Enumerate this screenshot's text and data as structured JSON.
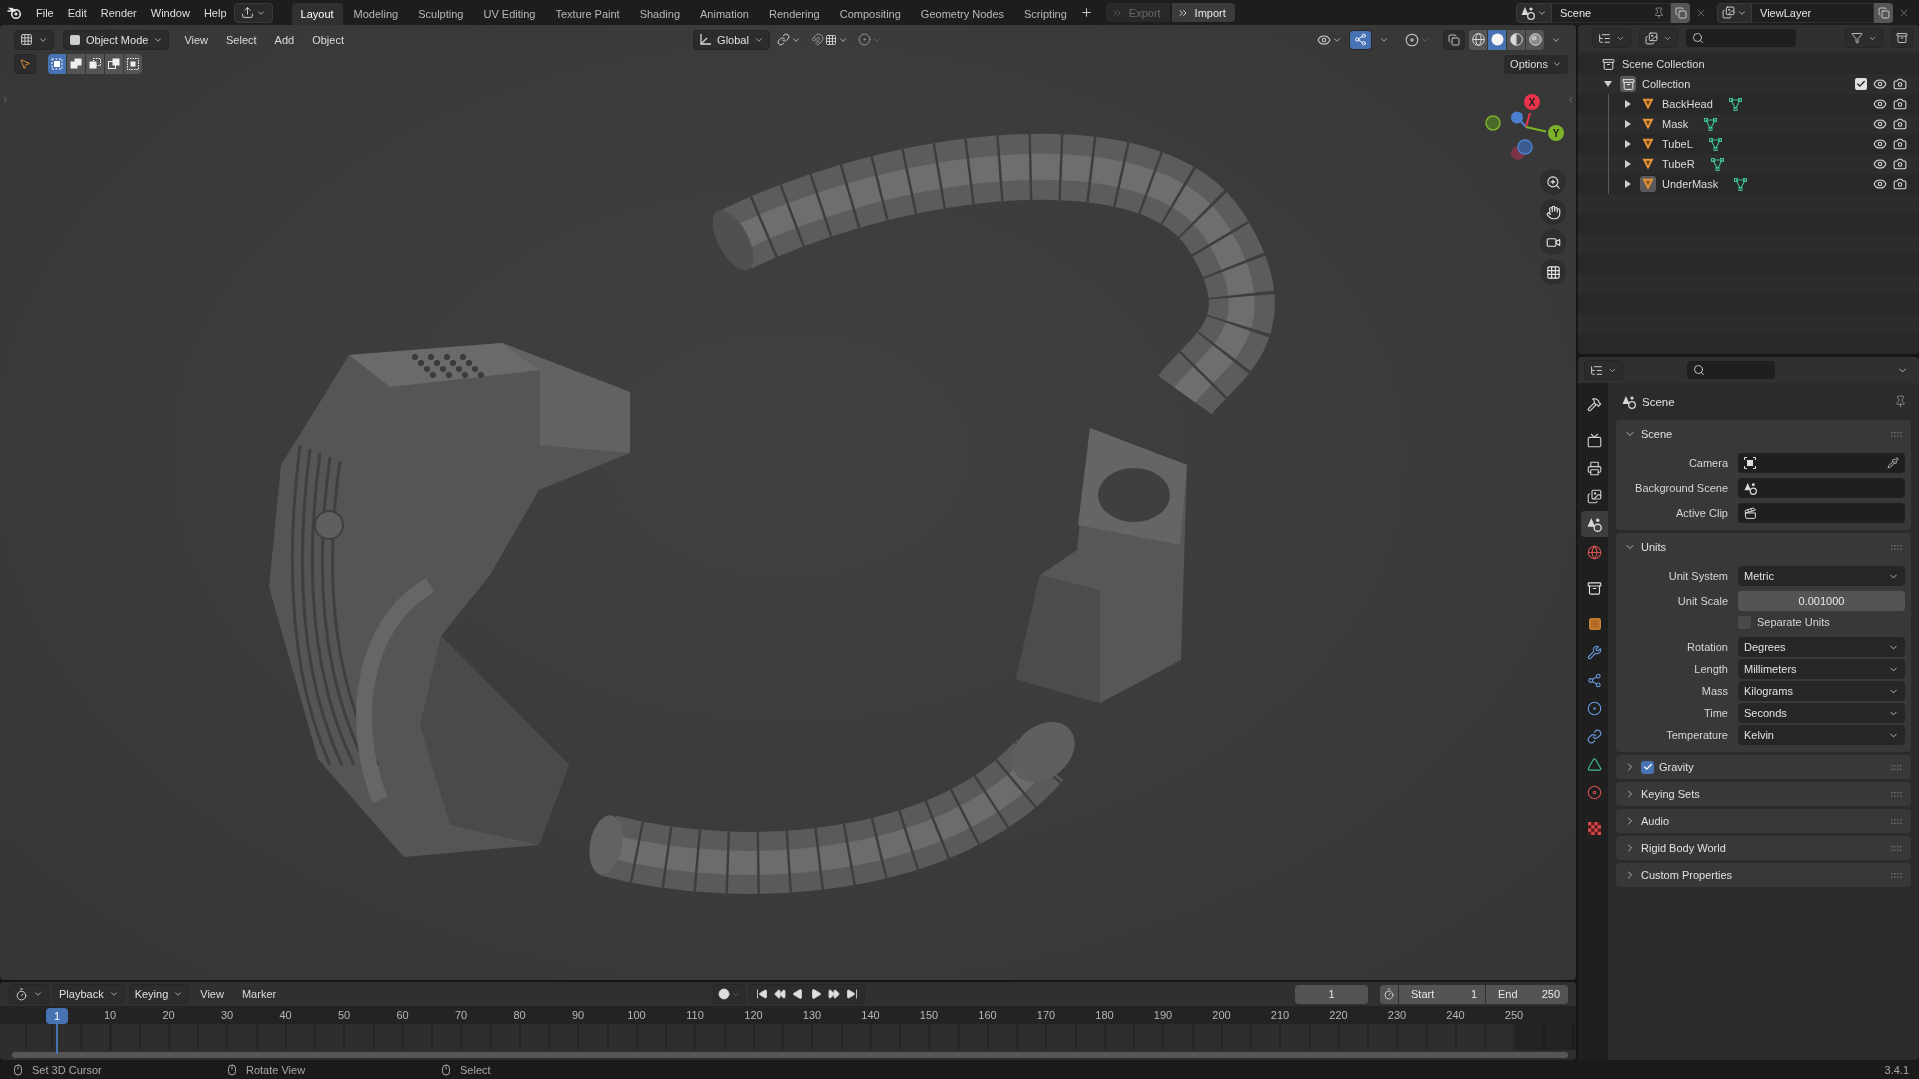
{
  "topbar": {
    "menus": [
      "File",
      "Edit",
      "Render",
      "Window",
      "Help"
    ],
    "workspaces": [
      {
        "label": "Layout",
        "selected": true
      },
      {
        "label": "Modeling",
        "selected": false
      },
      {
        "label": "Sculpting",
        "selected": false
      },
      {
        "label": "UV Editing",
        "selected": false
      },
      {
        "label": "Texture Paint",
        "selected": false
      },
      {
        "label": "Shading",
        "selected": false
      },
      {
        "label": "Animation",
        "selected": false
      },
      {
        "label": "Rendering",
        "selected": false
      },
      {
        "label": "Compositing",
        "selected": false
      },
      {
        "label": "Geometry Nodes",
        "selected": false
      },
      {
        "label": "Scripting",
        "selected": false
      }
    ],
    "export": {
      "label": "Export",
      "disabled": true
    },
    "import": {
      "label": "Import",
      "disabled": false
    },
    "scene": "Scene",
    "view_layer": "ViewLayer"
  },
  "viewport": {
    "mode": "Object Mode",
    "menus": [
      "View",
      "Select",
      "Add",
      "Object"
    ],
    "orientation": "Global",
    "gizmo_toggle_on": true,
    "shading": [
      {
        "kind": "wireframe",
        "selected": false
      },
      {
        "kind": "solid",
        "selected": true
      },
      {
        "kind": "material",
        "selected": false
      },
      {
        "kind": "rendered",
        "selected": false
      }
    ],
    "select_modes": [
      {
        "kind": "set",
        "selected": true
      },
      {
        "kind": "extend",
        "selected": false
      },
      {
        "kind": "subtract",
        "selected": false
      },
      {
        "kind": "invert",
        "selected": false
      },
      {
        "kind": "intersect",
        "selected": false
      }
    ],
    "options": "Options",
    "axes": [
      {
        "label": "X",
        "color": "#e8334a"
      },
      {
        "label": "Y",
        "color": "#7cb32a"
      }
    ]
  },
  "outliner": {
    "root": "Scene Collection",
    "collections": [
      {
        "name": "Collection",
        "expanded": true,
        "checked": true,
        "active": true,
        "children": [
          {
            "name": "BackHead",
            "expanded": false,
            "active": false
          },
          {
            "name": "Mask",
            "expanded": false,
            "active": false
          },
          {
            "name": "TubeL",
            "expanded": false,
            "active": false
          },
          {
            "name": "TubeR",
            "expanded": false,
            "active": false
          },
          {
            "name": "UnderMask",
            "expanded": false,
            "active": true
          }
        ]
      }
    ]
  },
  "properties": {
    "tabs": [
      {
        "kind": "tool",
        "selected": false
      },
      {
        "kind": "render",
        "selected": false
      },
      {
        "kind": "output",
        "selected": false
      },
      {
        "kind": "view_layer",
        "selected": false
      },
      {
        "kind": "scene",
        "selected": true
      },
      {
        "kind": "world",
        "selected": false
      },
      {
        "kind": "collection",
        "selected": false
      },
      {
        "kind": "object",
        "selected": false
      },
      {
        "kind": "modifiers",
        "selected": false
      },
      {
        "kind": "particles",
        "selected": false
      },
      {
        "kind": "physics",
        "selected": false
      },
      {
        "kind": "constraints",
        "selected": false
      },
      {
        "kind": "data",
        "selected": false
      },
      {
        "kind": "material",
        "selected": false
      },
      {
        "kind": "texture",
        "selected": false
      }
    ],
    "context": "Scene",
    "panels": [
      {
        "title": "Scene",
        "expanded": true,
        "rows": [
          {
            "kind": "camera",
            "label": "Camera"
          },
          {
            "kind": "scene",
            "label": "Background Scene"
          },
          {
            "kind": "clip",
            "label": "Active Clip"
          }
        ]
      },
      {
        "title": "Units",
        "expanded": true,
        "rows": [
          {
            "kind": "dropdown",
            "label": "Unit System",
            "value": "Metric"
          },
          {
            "kind": "number",
            "label": "Unit Scale",
            "value": "0.001000"
          },
          {
            "kind": "checkbox",
            "label": "Separate Units",
            "checked": false
          },
          {
            "kind": "dropdown",
            "label": "Rotation",
            "value": "Degrees"
          },
          {
            "kind": "dropdown",
            "label": "Length",
            "value": "Millimeters"
          },
          {
            "kind": "dropdown",
            "label": "Mass",
            "value": "Kilograms"
          },
          {
            "kind": "dropdown",
            "label": "Time",
            "value": "Seconds"
          },
          {
            "kind": "dropdown",
            "label": "Temperature",
            "value": "Kelvin"
          }
        ]
      },
      {
        "title": "Gravity",
        "expanded": false,
        "toggle": {
          "checked": true
        }
      },
      {
        "title": "Keying Sets",
        "expanded": false
      },
      {
        "title": "Audio",
        "expanded": false
      },
      {
        "title": "Rigid Body World",
        "expanded": false
      },
      {
        "title": "Custom Properties",
        "expanded": false
      }
    ]
  },
  "timeline": {
    "menus": [
      {
        "label": "Playback",
        "kind": "dropdown"
      },
      {
        "label": "Keying",
        "kind": "dropdown"
      },
      {
        "label": "View",
        "kind": "menu"
      },
      {
        "label": "Marker",
        "kind": "menu"
      }
    ],
    "current_frame": "1",
    "start_label": "Start",
    "start": "1",
    "end_label": "End",
    "end": "250",
    "playhead": "1",
    "ruler": [
      "10",
      "20",
      "30",
      "40",
      "50",
      "60",
      "70",
      "80",
      "90",
      "100",
      "110",
      "120",
      "130",
      "140",
      "150",
      "160",
      "170",
      "180",
      "190",
      "200",
      "210",
      "220",
      "230",
      "240",
      "250"
    ]
  },
  "status_bar": {
    "hints": [
      "Set 3D Cursor",
      "Rotate View",
      "Select"
    ],
    "version": "3.4.1"
  }
}
